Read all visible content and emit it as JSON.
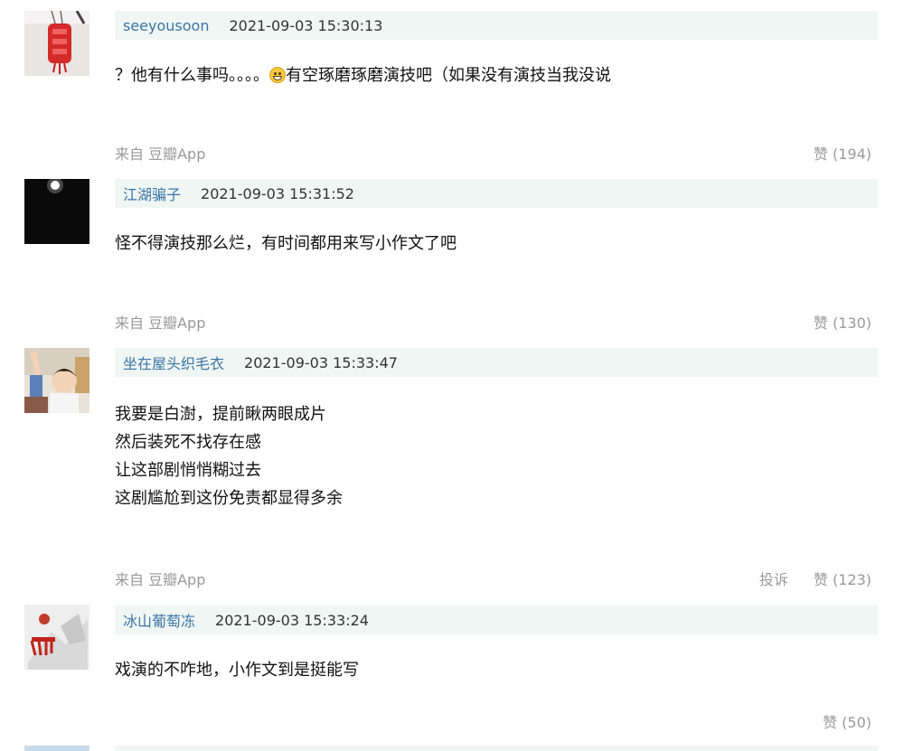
{
  "comments": [
    {
      "user": "seeyousoon",
      "time": "2021-09-03 15:30:13",
      "text_before_emoji": "？他有什么事吗。。。。",
      "emoji": "grinning-sweat-emoji",
      "text_after_emoji": "有空琢磨琢磨演技吧（如果没有演技当我没说",
      "source": "来自 豆瓣App",
      "likes": "赞 (194)"
    },
    {
      "user": "江湖骗子",
      "time": "2021-09-03 15:31:52",
      "lines": [
        "怪不得演技那么烂，有时间都用来写小作文了吧"
      ],
      "source": "来自 豆瓣App",
      "likes": "赞 (130)"
    },
    {
      "user": "坐在屋头织毛衣",
      "time": "2021-09-03 15:33:47",
      "lines": [
        "我要是白澍，提前瞅两眼成片",
        "然后装死不找存在感",
        "让这部剧悄悄糊过去",
        "这剧尴尬到这份免责都显得多余"
      ],
      "source": "来自 豆瓣App",
      "report": "投诉",
      "likes": "赞 (123)"
    },
    {
      "user": "冰山葡萄冻",
      "time": "2021-09-03 15:33:24",
      "lines": [
        "戏演的不咋地，小作文到是挺能写"
      ],
      "likes": "赞 (50)"
    }
  ],
  "colors": {
    "meta_bar_bg": "#f0f6f3",
    "username": "#3a76a8",
    "muted": "#999999"
  }
}
